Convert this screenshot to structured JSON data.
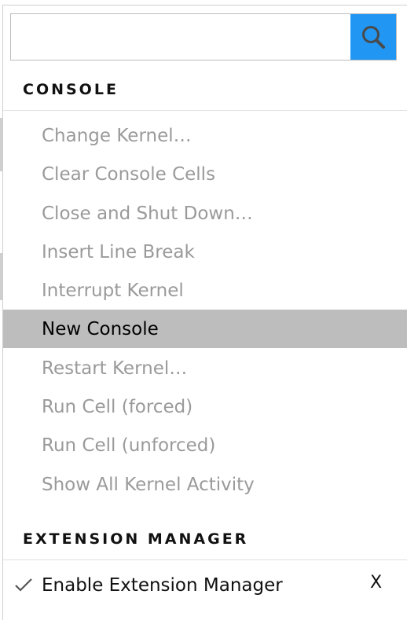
{
  "search": {
    "value": "",
    "placeholder": ""
  },
  "sections": [
    {
      "header": "CONSOLE",
      "items": [
        {
          "label": "Change Kernel…",
          "state": "disabled"
        },
        {
          "label": "Clear Console Cells",
          "state": "disabled"
        },
        {
          "label": "Close and Shut Down…",
          "state": "disabled"
        },
        {
          "label": "Insert Line Break",
          "state": "disabled"
        },
        {
          "label": "Interrupt Kernel",
          "state": "disabled"
        },
        {
          "label": "New Console",
          "state": "active"
        },
        {
          "label": "Restart Kernel…",
          "state": "disabled"
        },
        {
          "label": "Run Cell (forced)",
          "state": "disabled"
        },
        {
          "label": "Run Cell (unforced)",
          "state": "disabled"
        },
        {
          "label": "Show All Kernel Activity",
          "state": "disabled"
        }
      ]
    },
    {
      "header": "EXTENSION MANAGER",
      "items": [
        {
          "label": "Enable Extension Manager",
          "state": "enabled",
          "checked": true
        }
      ]
    }
  ],
  "close_label": "X",
  "colors": {
    "search_button": "#2196f3",
    "active_row": "#bdbdbd",
    "disabled_text": "#9a9a9a"
  },
  "icons": {
    "search": "search-icon",
    "check": "check-icon"
  }
}
